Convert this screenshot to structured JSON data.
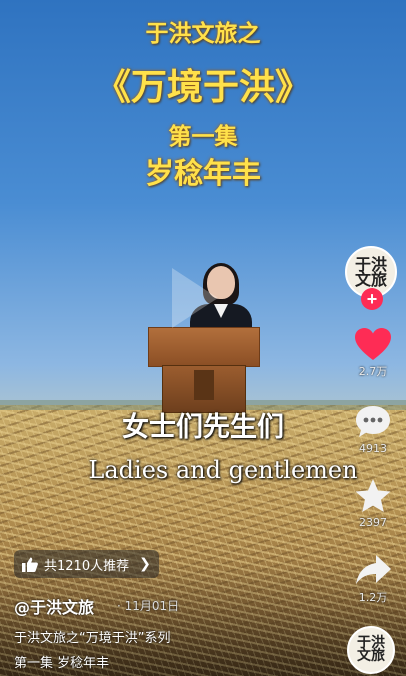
{
  "video": {
    "title_line1": "于洪文旅之",
    "title_line2": "《万境于洪》",
    "title_line3": "第一集",
    "title_line4": "岁稔年丰",
    "subtitle_cn": "女士们先生们",
    "subtitle_en": "Ladies and gentlemen"
  },
  "sidebar": {
    "avatar_text": "于洪文旅",
    "follow_label": "+",
    "like_count": "2.7万",
    "comment_count": "4913",
    "favorite_count": "2397",
    "share_count": "1.2万",
    "like_color": "#fe2c55",
    "icons": [
      "heart-icon",
      "comment-icon",
      "star-icon",
      "share-icon"
    ]
  },
  "recommend": {
    "label": "共1210人推荐",
    "icon": "thumbs-up-icon"
  },
  "info": {
    "author": "@于洪文旅",
    "date": "· 11月01日",
    "desc_line1": "于洪文旅之“万境于洪”系列",
    "desc_line2": "第一集  岁稔年丰"
  },
  "music": {
    "disc_text": "于洪文旅"
  }
}
